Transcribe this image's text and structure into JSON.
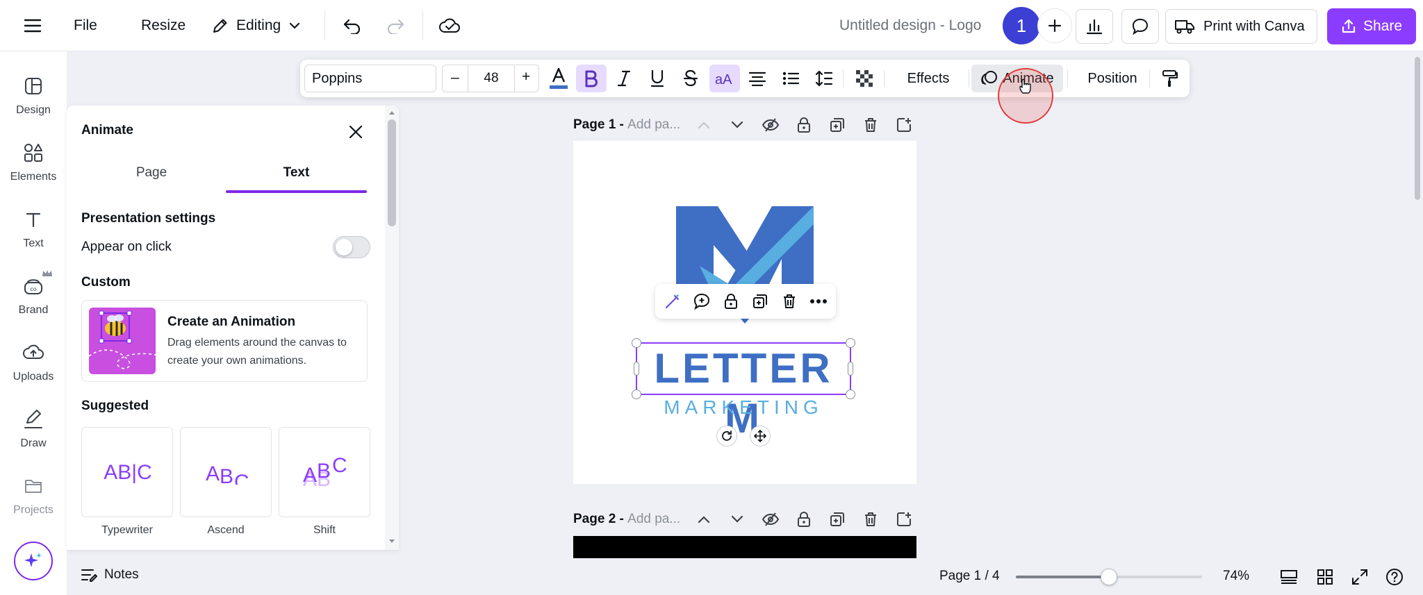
{
  "topbar": {
    "file_label": "File",
    "resize_label": "Resize",
    "editing_label": "Editing",
    "design_title": "Untitled design - Logo",
    "avatar_number": "1",
    "print_label": "Print with Canva",
    "share_label": "Share"
  },
  "rail": {
    "items": [
      {
        "label": "Design",
        "icon": "layout-icon"
      },
      {
        "label": "Elements",
        "icon": "shapes-icon"
      },
      {
        "label": "Text",
        "icon": "text-t-icon"
      },
      {
        "label": "Brand",
        "icon": "brand-icon"
      },
      {
        "label": "Uploads",
        "icon": "cloud-upload-icon"
      },
      {
        "label": "Draw",
        "icon": "pen-icon"
      },
      {
        "label": "Projects",
        "icon": "folder-icon"
      }
    ]
  },
  "toolbar": {
    "font_name": "Poppins",
    "font_size": "48",
    "minus_label": "–",
    "plus_label": "+",
    "effects_label": "Effects",
    "animate_label": "Animate",
    "position_label": "Position"
  },
  "panel": {
    "title": "Animate",
    "tabs": [
      {
        "label": "Page",
        "active": false
      },
      {
        "label": "Text",
        "active": true
      }
    ],
    "presentation_heading": "Presentation settings",
    "appear_on_click_label": "Appear on click",
    "appear_on_click_enabled": false,
    "custom_heading": "Custom",
    "create_title": "Create an Animation",
    "create_desc_line1": "Drag elements around the canvas to",
    "create_desc_line2": "create your own animations.",
    "suggested_heading": "Suggested",
    "suggested": [
      {
        "label": "Typewriter",
        "preview": "AB|C"
      },
      {
        "label": "Ascend",
        "preview": "ABC"
      },
      {
        "label": "Shift",
        "preview": "ABC"
      }
    ]
  },
  "canvas": {
    "page1_label": "Page 1 -",
    "page1_sub": "Add pa...",
    "page2_label": "Page 2 -",
    "page2_sub": "Add pa...",
    "logo_title": "LETTER M",
    "logo_subtitle": "MARKETING"
  },
  "bottombar": {
    "notes_label": "Notes",
    "page_indicator": "Page 1 / 4",
    "zoom_label": "74%",
    "zoom_level_fraction": 0.5
  },
  "colors": {
    "accent": "#7d2ae8",
    "brand_blue": "#3f6fc4",
    "light_blue": "#58aee0",
    "share_bg": "#8b3dff"
  }
}
